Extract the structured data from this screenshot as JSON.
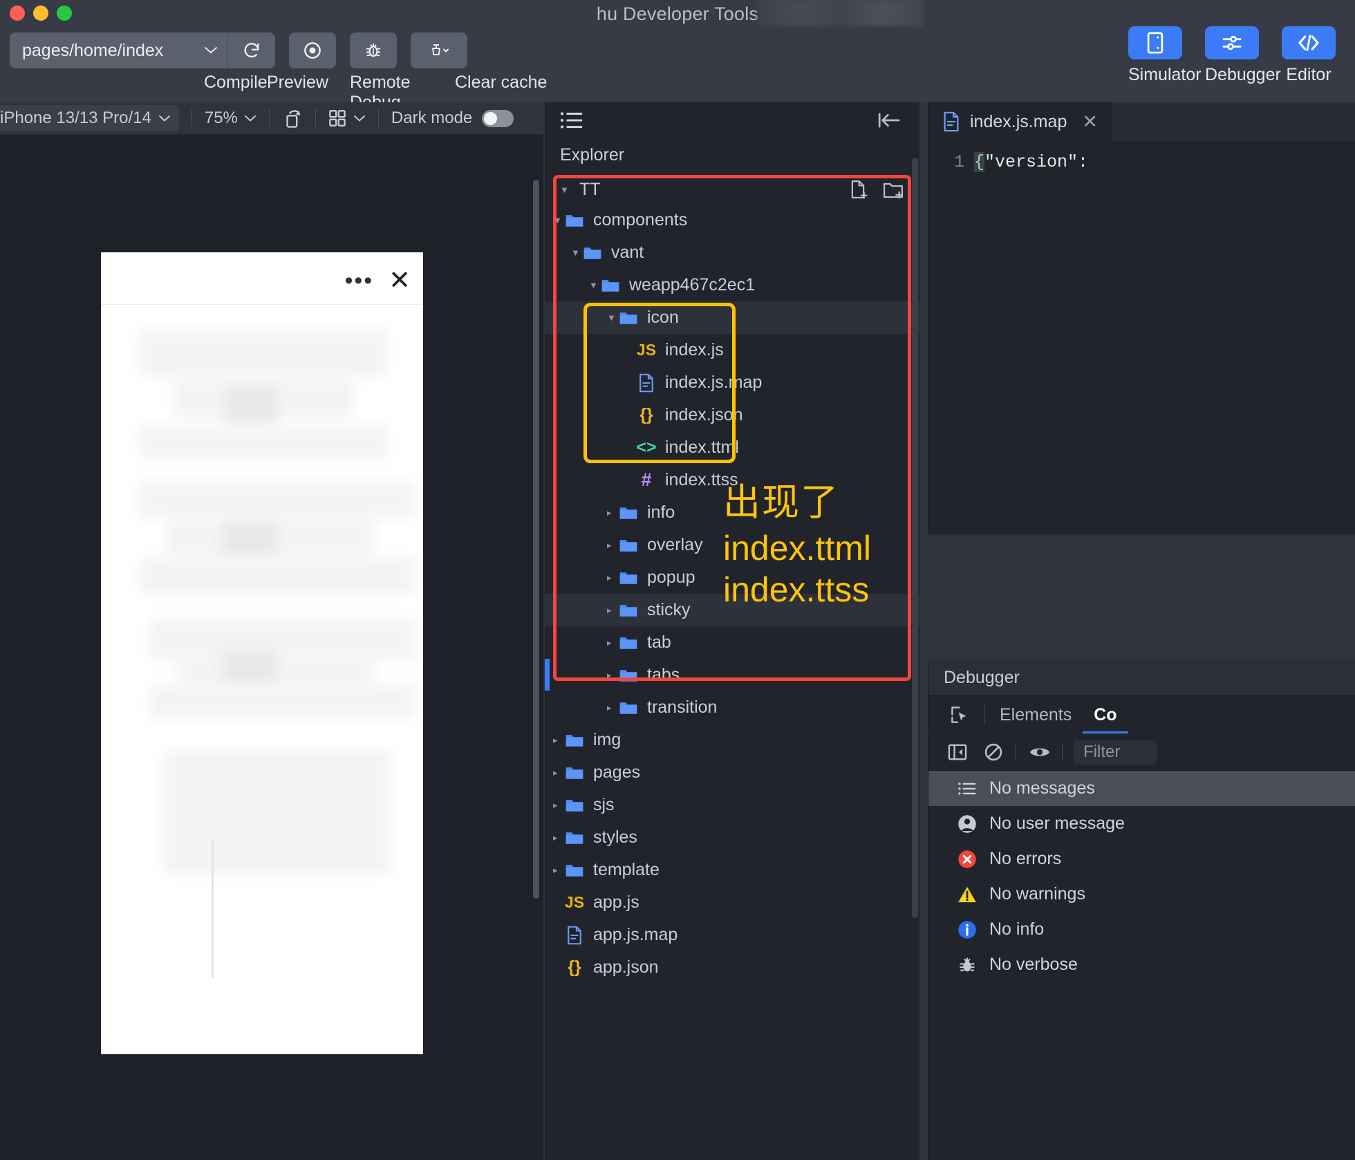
{
  "window": {
    "title": "hu Developer Tools",
    "traffic_lights": [
      "close",
      "minimize",
      "maximize"
    ]
  },
  "toolbar": {
    "page_path": "pages/home/index",
    "actions": [
      {
        "label": "Compile",
        "icon": "refresh-icon"
      },
      {
        "label": "Preview",
        "icon": "eye-icon"
      },
      {
        "label": "Remote Debug",
        "icon": "bug-icon"
      },
      {
        "label": "Clear cache",
        "icon": "broom-icon"
      }
    ],
    "modes": [
      {
        "label": "Simulator",
        "icon": "phone-icon",
        "active": true,
        "color": "#3b7cf6"
      },
      {
        "label": "Debugger",
        "icon": "sliders-icon",
        "active": true,
        "color": "#3b7cf6"
      },
      {
        "label": "Editor",
        "icon": "code-icon",
        "active": true,
        "color": "#3b7cf6"
      }
    ]
  },
  "device_bar": {
    "device": "iPhone 13/13 Pro/14",
    "zoom": "75%",
    "rotate_icon": "rotate-icon",
    "layout_icon": "grid-icon",
    "dark_mode_label": "Dark mode",
    "dark_mode_on": false
  },
  "explorer": {
    "panel_title": "Explorer",
    "list_icon": "list-icon",
    "collapse_icon": "collapse-left-icon",
    "root": "TT",
    "new_file_icon": "new-file-icon",
    "new_folder_icon": "new-folder-icon",
    "tree": [
      {
        "name": "components",
        "type": "folder",
        "open": true,
        "depth": 1
      },
      {
        "name": "vant",
        "type": "folder",
        "open": true,
        "depth": 2
      },
      {
        "name": "weapp467c2ec1",
        "type": "folder",
        "open": true,
        "depth": 3
      },
      {
        "name": "icon",
        "type": "folder",
        "open": true,
        "depth": 4,
        "selected": true
      },
      {
        "name": "index.js",
        "type": "js",
        "depth": 5
      },
      {
        "name": "index.js.map",
        "type": "map",
        "depth": 5
      },
      {
        "name": "index.json",
        "type": "json",
        "depth": 5
      },
      {
        "name": "index.ttml",
        "type": "ttml",
        "depth": 5
      },
      {
        "name": "index.ttss",
        "type": "ttss",
        "depth": 5
      },
      {
        "name": "info",
        "type": "folder",
        "open": false,
        "depth": 4
      },
      {
        "name": "overlay",
        "type": "folder",
        "open": false,
        "depth": 4
      },
      {
        "name": "popup",
        "type": "folder",
        "open": false,
        "depth": 4
      },
      {
        "name": "sticky",
        "type": "folder",
        "open": false,
        "depth": 4,
        "selected": true
      },
      {
        "name": "tab",
        "type": "folder",
        "open": false,
        "depth": 4
      },
      {
        "name": "tabs",
        "type": "folder",
        "open": false,
        "depth": 4
      },
      {
        "name": "transition",
        "type": "folder",
        "open": false,
        "depth": 4
      },
      {
        "name": "img",
        "type": "folder",
        "open": false,
        "depth": 1
      },
      {
        "name": "pages",
        "type": "folder",
        "open": false,
        "depth": 1
      },
      {
        "name": "sjs",
        "type": "folder",
        "open": false,
        "depth": 1
      },
      {
        "name": "styles",
        "type": "folder",
        "open": false,
        "depth": 1
      },
      {
        "name": "template",
        "type": "folder",
        "open": false,
        "depth": 1
      },
      {
        "name": "app.js",
        "type": "js",
        "depth": 1
      },
      {
        "name": "app.js.map",
        "type": "map",
        "depth": 1
      },
      {
        "name": "app.json",
        "type": "json",
        "depth": 1
      }
    ]
  },
  "annotation": {
    "line1": "出现了",
    "line2": "index.ttml",
    "line3": "index.ttss",
    "color": "#ffc40c",
    "box_red": "#f4463f",
    "box_yellow": "#ffc107"
  },
  "editor": {
    "tab_name": "index.js.map",
    "tab_icon": "map-file-icon",
    "close_icon": "close-icon",
    "line_number": "1",
    "code_brace": "{",
    "code_text": "\"version\":"
  },
  "debugger": {
    "panel_title": "Debugger",
    "inspect_icon": "inspect-icon",
    "tabs": [
      {
        "label": "Elements",
        "active": false
      },
      {
        "label": "Co",
        "active": true
      }
    ],
    "toolbar_icons": [
      "sidebar-toggle-icon",
      "clear-console-icon",
      "eye-icon"
    ],
    "filter_placeholder": "Filter",
    "messages": [
      {
        "label": "No messages",
        "icon": "list-icon",
        "selected": true
      },
      {
        "label": "No user message",
        "icon": "user-icon"
      },
      {
        "label": "No errors",
        "icon": "error-icon"
      },
      {
        "label": "No warnings",
        "icon": "warning-icon"
      },
      {
        "label": "No info",
        "icon": "info-icon"
      },
      {
        "label": "No verbose",
        "icon": "bug-icon"
      }
    ]
  }
}
